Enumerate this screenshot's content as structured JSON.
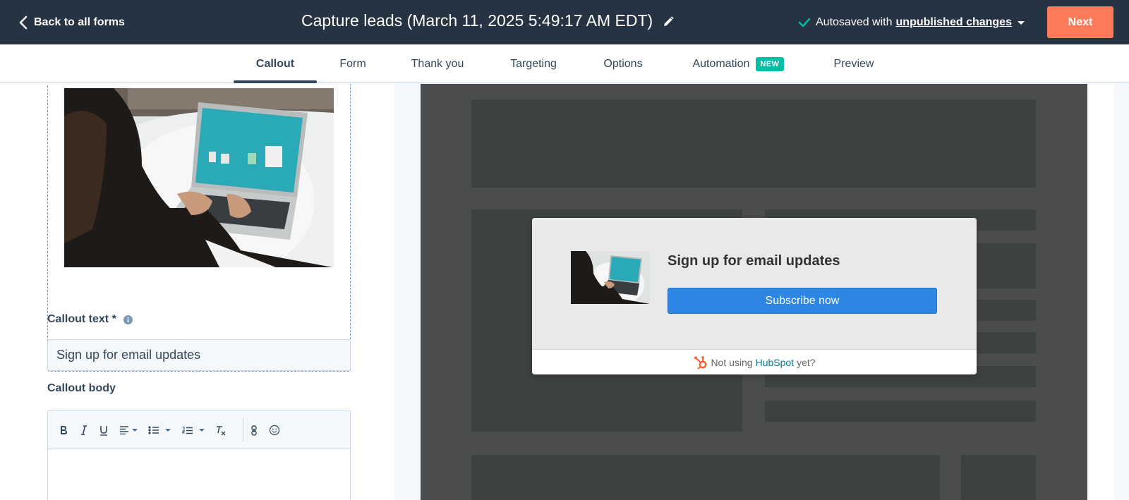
{
  "header": {
    "back_label": "Back to all forms",
    "title": "Capture leads (March 11, 2025 5:49:17 AM EDT)",
    "autosave_prefix": "Autosaved with",
    "autosave_link": "unpublished changes",
    "next_label": "Next"
  },
  "tabs": [
    {
      "label": "Callout",
      "active": true
    },
    {
      "label": "Form"
    },
    {
      "label": "Thank you"
    },
    {
      "label": "Targeting"
    },
    {
      "label": "Options"
    },
    {
      "label": "Automation",
      "badge": "NEW"
    },
    {
      "label": "Preview"
    }
  ],
  "editor": {
    "callout_text_label": "Callout text *",
    "callout_text_value": "Sign up for email updates",
    "callout_body_label": "Callout body"
  },
  "preview": {
    "heading": "Sign up for email updates",
    "button_label": "Subscribe now",
    "footer_prefix": "Not using",
    "footer_link": "HubSpot",
    "footer_suffix": "yet?"
  },
  "colors": {
    "header_bg": "#253342",
    "accent": "#ff7a59",
    "badge": "#00bda5",
    "preview_button": "#2d86e1"
  }
}
